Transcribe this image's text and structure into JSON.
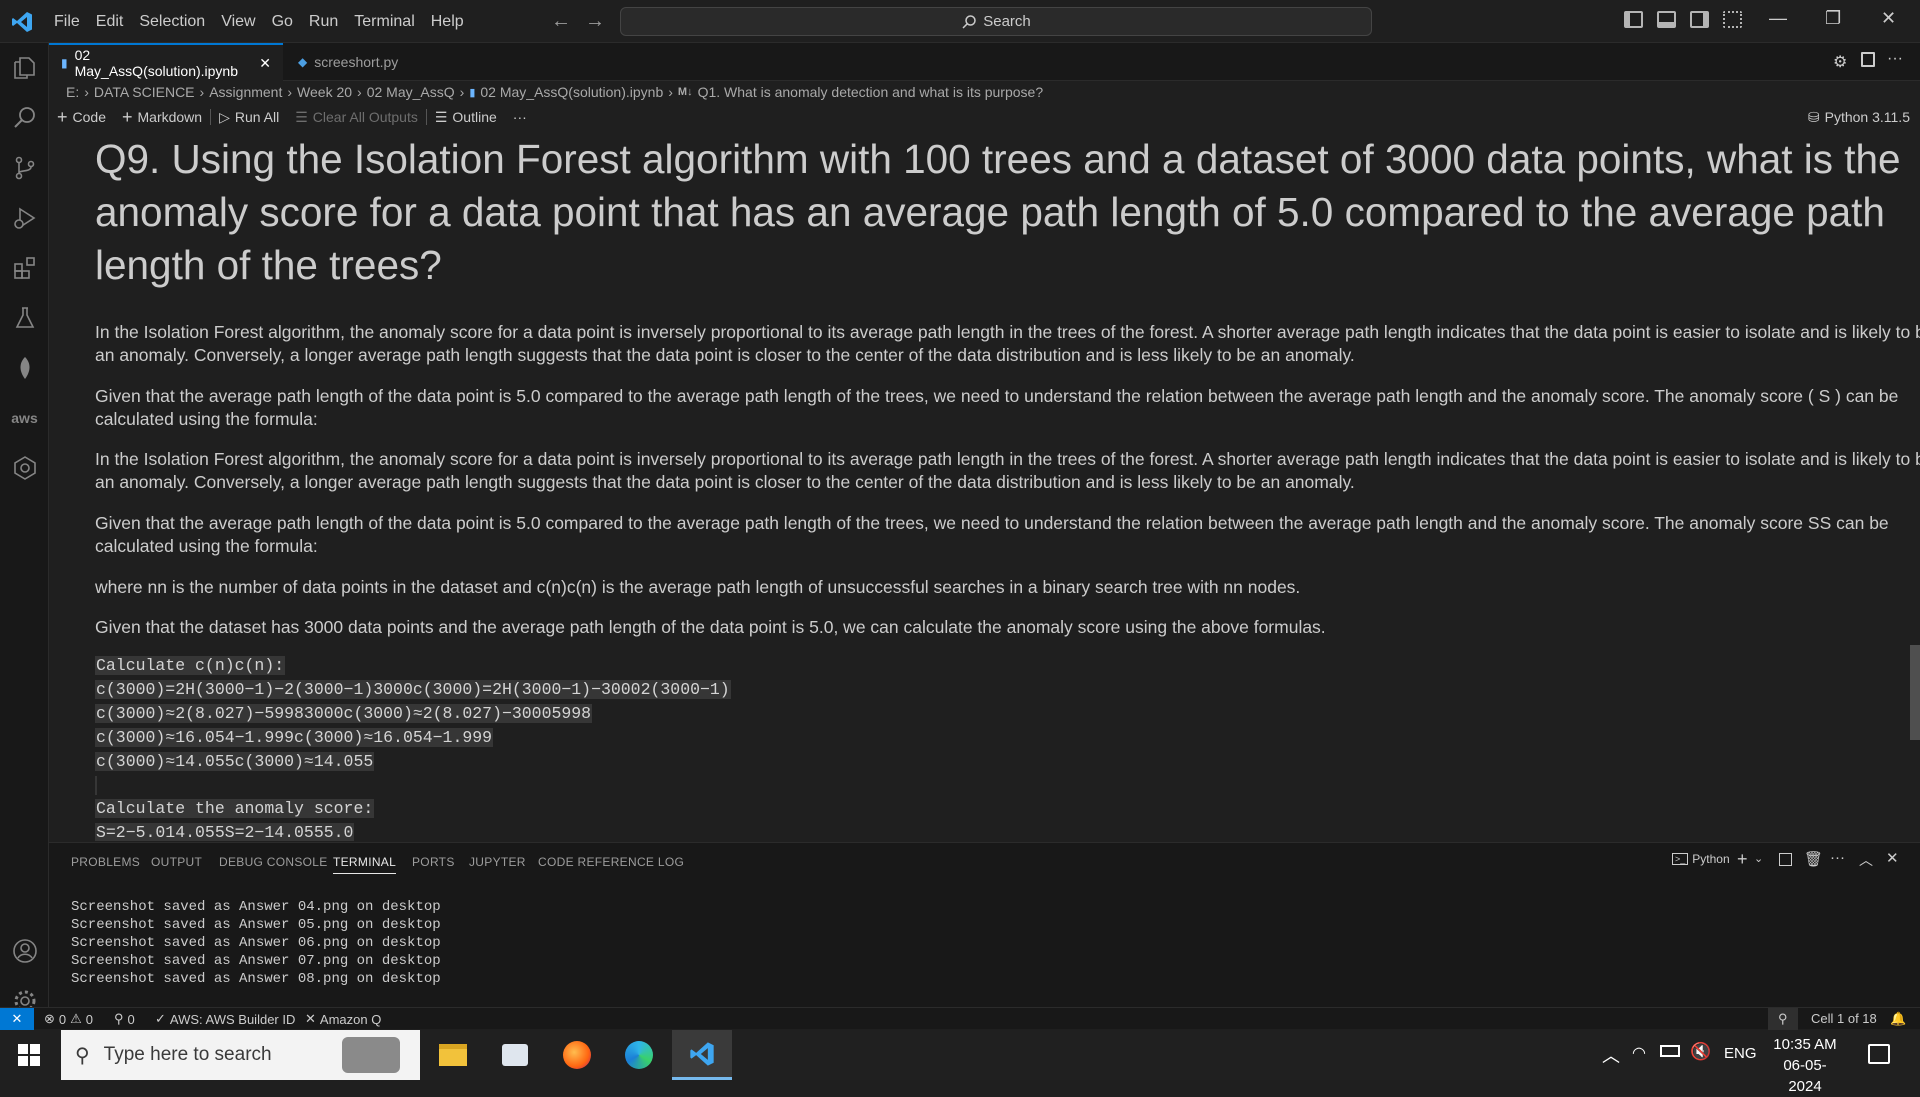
{
  "titlebar": {
    "menu": [
      "File",
      "Edit",
      "Selection",
      "View",
      "Go",
      "Run",
      "Terminal",
      "Help"
    ],
    "search_label": "Search"
  },
  "tabs": [
    {
      "label": "02 May_AssQ(solution).ipynb",
      "active": true
    },
    {
      "label": "screeshort.py",
      "active": false
    }
  ],
  "breadcrumb": [
    "E:",
    "DATA SCIENCE",
    "Assignment",
    "Week 20",
    "02 May_AssQ",
    "02 May_AssQ(solution).ipynb",
    "Q1. What is anomaly detection and what is its purpose?"
  ],
  "breadcrumb_md_label": "M↓",
  "toolbar": {
    "code_label": "Code",
    "markdown_label": "Markdown",
    "run_all_label": "Run All",
    "clear_label": "Clear All Outputs",
    "outline_label": "Outline",
    "more_label": "···",
    "kernel_label": "Python 3.11.5"
  },
  "notebook": {
    "heading": "Q9. Using the Isolation Forest algorithm with 100 trees and a dataset of 3000 data points, what is the anomaly score for a data point that has an average path length of 5.0 compared to the average path length of the trees?",
    "paragraphs": [
      "In the Isolation Forest algorithm, the anomaly score for a data point is inversely proportional to its average path length in the trees of the forest. A shorter average path length indicates that the data point is easier to isolate and is likely to be an anomaly. Conversely, a longer average path length suggests that the data point is closer to the center of the data distribution and is less likely to be an anomaly.",
      "Given that the average path length of the data point is 5.0 compared to the average path length of the trees, we need to understand the relation between the average path length and the anomaly score. The anomaly score ( S ) can be calculated using the formula:",
      "In the Isolation Forest algorithm, the anomaly score for a data point is inversely proportional to its average path length in the trees of the forest. A shorter average path length indicates that the data point is easier to isolate and is likely to be an anomaly. Conversely, a longer average path length suggests that the data point is closer to the center of the data distribution and is less likely to be an anomaly.",
      "Given that the average path length of the data point is 5.0 compared to the average path length of the trees, we need to understand the relation between the average path length and the anomaly score. The anomaly score SS can be calculated using the formula:",
      "where nn is the number of data points in the dataset and c(n)c(n) is the average path length of unsuccessful searches in a binary search tree with nn nodes.",
      "Given that the dataset has 3000 data points and the average path length of the data point is 5.0, we can calculate the anomaly score using the above formulas."
    ],
    "code_lines": [
      "Calculate c(n)c(n):",
      "c(3000)=2H(3000−1)−2(3000−1)3000c(3000)=2H(3000−1)−30002(3000−1)",
      "c(3000)≈2(8.027)−59983000c(3000)≈2(8.027)−30005998",
      "c(3000)≈16.054−1.999c(3000)≈16.054−1.999",
      "c(3000)≈14.055c(3000)≈14.055",
      "",
      "Calculate the anomaly score:",
      "S=2−5.014.055S=2−14.0555.0"
    ]
  },
  "panel": {
    "tabs": [
      "PROBLEMS",
      "OUTPUT",
      "DEBUG CONSOLE",
      "TERMINAL",
      "PORTS",
      "JUPYTER",
      "CODE REFERENCE LOG"
    ],
    "active_tab": "TERMINAL",
    "shell_label": "Python",
    "terminal_lines": [
      "Screenshot saved as Answer 04.png on desktop",
      "Screenshot saved as Answer 05.png on desktop",
      "Screenshot saved as Answer 06.png on desktop",
      "Screenshot saved as Answer 07.png on desktop",
      "Screenshot saved as Answer 08.png on desktop"
    ]
  },
  "statusbar": {
    "errors": "0",
    "warnings": "0",
    "ports": "0",
    "aws_label": "AWS: AWS Builder ID",
    "amazonq_label": "Amazon Q",
    "cell_label": "Cell 1 of 18"
  },
  "taskbar": {
    "search_placeholder": "Type here to search",
    "lang": "ENG",
    "time": "10:35 AM",
    "date": "06-05-2024"
  },
  "colors": {
    "accent": "#0078d4",
    "editor_bg": "#1f1f1f",
    "sidebar_bg": "#181818"
  }
}
